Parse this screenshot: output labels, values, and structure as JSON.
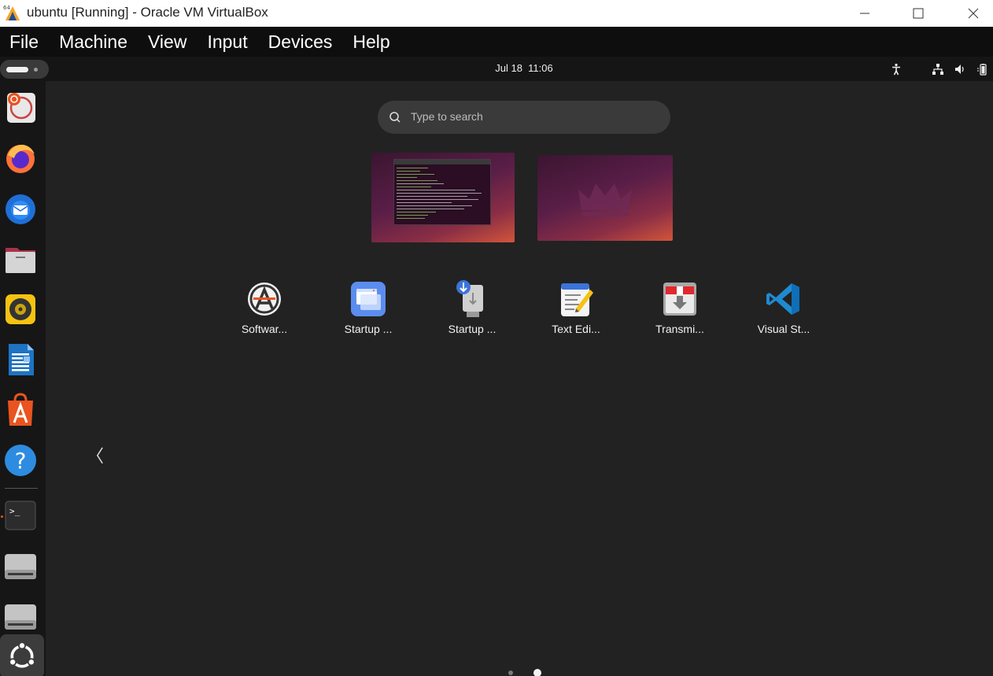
{
  "window": {
    "title": "ubuntu [Running] - Oracle VM VirtualBox",
    "controls": [
      "minimize-icon",
      "maximize-icon",
      "close-icon"
    ]
  },
  "menubar": {
    "items": [
      "File",
      "Machine",
      "View",
      "Input",
      "Devices",
      "Help"
    ]
  },
  "topbar": {
    "date": "Jul 18",
    "time": "11:06",
    "tray_icons": [
      "accessibility-icon",
      "network-icon",
      "volume-icon",
      "battery-icon"
    ]
  },
  "dock": {
    "items": [
      {
        "name": "Ubuntu Desktop Guide"
      },
      {
        "name": "Firefox"
      },
      {
        "name": "Thunderbird Mail"
      },
      {
        "name": "Files"
      },
      {
        "name": "Rhythmbox"
      },
      {
        "name": "LibreOffice Writer"
      },
      {
        "name": "Ubuntu Software"
      },
      {
        "name": "Help"
      },
      {
        "name": "Terminal"
      },
      {
        "name": "Drive 1"
      },
      {
        "name": "Drive 2"
      },
      {
        "name": "Show Applications"
      }
    ]
  },
  "search": {
    "placeholder": "Type to search"
  },
  "workspaces": [
    "Workspace 1",
    "Workspace 2"
  ],
  "apps": [
    {
      "label": "Softwar...",
      "icon": "software-updater-icon"
    },
    {
      "label": "Startup ...",
      "icon": "startup-applications-icon"
    },
    {
      "label": "Startup ...",
      "icon": "startup-disk-creator-icon"
    },
    {
      "label": "Text Edi...",
      "icon": "text-editor-icon"
    },
    {
      "label": "Transmi...",
      "icon": "transmission-icon"
    },
    {
      "label": "Visual St...",
      "icon": "vscode-icon"
    }
  ],
  "pagination": {
    "pages": 2,
    "current": 2,
    "prev_glyph": "〈"
  },
  "colors": {
    "accent": "#e95420",
    "guest_bg": "#222222",
    "topbar_bg": "#151515",
    "menubar_bg": "#0e0e0e"
  }
}
